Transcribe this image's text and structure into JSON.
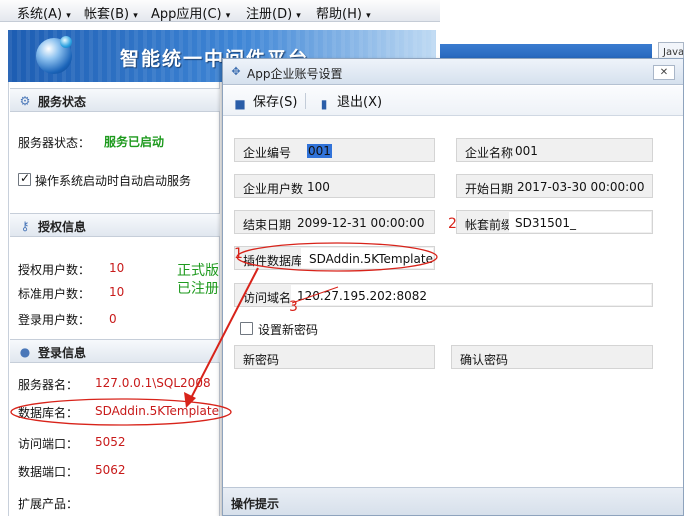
{
  "menubar": {
    "items": [
      "系统(A)",
      "帐套(B)",
      "App应用(C)",
      "注册(D)",
      "帮助(H)"
    ],
    "arrow": "▾"
  },
  "background": {
    "tab_text": "Javas"
  },
  "banner": {
    "title": "智能统一中间件平台"
  },
  "left_panel": {
    "server_section": {
      "title": "服务状态",
      "status_label": "服务器状态：",
      "status_value": "服务已启动",
      "autostart_label": "操作系统启动时自动启动服务",
      "autostart_checked": true
    },
    "license_section": {
      "title": "授权信息",
      "licensed_users_label": "授权用户数：",
      "licensed_users_value": "10",
      "standard_users_label": "标准用户数：",
      "standard_users_value": "10",
      "logged_users_label": "登录用户数：",
      "logged_users_value": "0",
      "edition_line1": "正式版",
      "edition_line2": "已注册"
    },
    "login_section": {
      "title": "登录信息",
      "server_name_label": "服务器名：",
      "server_name_value": "127.0.0.1\\SQL2008",
      "db_name_label": "数据库名：",
      "db_name_value": "SDAddin.5KTemplate",
      "access_port_label": "访问端口：",
      "access_port_value": "5052",
      "data_port_label": "数据端口：",
      "data_port_value": "5062",
      "extension_label": "扩展产品："
    }
  },
  "dialog": {
    "title": "App企业账号设置",
    "close_glyph": "✕",
    "toolbar": {
      "save_label": "保存(S)",
      "exit_label": "退出(X)"
    },
    "fields": {
      "company_code_label": "企业编号",
      "company_code_value": "001",
      "company_name_label": "企业名称",
      "company_name_value": "001",
      "user_count_label": "企业用户数",
      "user_count_value": "100",
      "start_date_label": "开始日期",
      "start_date_value": "2017-03-30 00:00:00",
      "end_date_label": "结束日期",
      "end_date_value": "2099-12-31 00:00:00",
      "prefix_label": "帐套前缀",
      "prefix_value": "SD31501_",
      "plugin_db_label": "插件数据库",
      "plugin_db_value": "SDAddin.5KTemplate",
      "domain_label": "访问域名",
      "domain_value": "120.27.195.202:8082",
      "set_password_label": "设置新密码",
      "set_password_checked": false,
      "new_password_label": "新密码",
      "confirm_password_label": "确认密码"
    },
    "footer_label": "操作提示"
  },
  "annotations": {
    "one": "1",
    "two": "2",
    "three": "3",
    "color": "#d8231a"
  },
  "icons": {
    "server_section": "gear-icon",
    "license_section": "key-icon",
    "login_section": "user-icon",
    "save": "save-icon",
    "exit": "exit-icon",
    "dialog": "puzzle-icon"
  }
}
